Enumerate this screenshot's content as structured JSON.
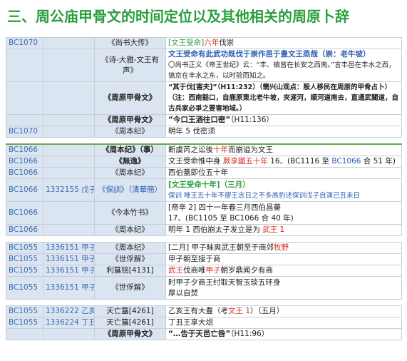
{
  "heading": "三、周公庙甲骨文的时间定位以及其他相关的周原卜辞",
  "rows": [
    {
      "c1": "BC1070",
      "c2": "",
      "c3": "《尚书大传》",
      "c4": [
        [
          "[文王受命]",
          "green"
        ],
        [
          "六年",
          "red"
        ],
        [
          "伐崇",
          ""
        ]
      ]
    },
    {
      "c1": "",
      "c2": "",
      "c3": "《诗-大雅-文王有声》",
      "c4a": "文王受命有此武功既伐于崇作邑于豊文王烝哉（崇：老牛坡）",
      "c4b": "〇尚书正义《帝王世纪》云：“丰、镐皆在长安之西南。”言丰邑在丰水之西，镐京在丰水之东，以时验而知之。"
    },
    {
      "c1": "",
      "c2": "",
      "c3": "《周原甲骨文》",
      "c4a": "“其于伐[害夫]”（H11:232）（需兴山观点：殷人移民在周原的甲骨占卜）",
      "c4b": "（注：西南豁口，自鹿原東北老牛坡，夾滻河，順河道南去，直通武關道，自古兵家必爭之要害地域。）"
    },
    {
      "c1": "",
      "c2": "",
      "c3": "《周原甲骨文》",
      "c4": [
        [
          "“今口王酒往口密”",
          "b"
        ],
        [
          "（H11:136）",
          ""
        ]
      ]
    },
    {
      "c1": "BC1070",
      "c2": "",
      "c3": "《周本纪》",
      "c4": [
        [
          "明年 5 伐密须",
          ""
        ]
      ]
    },
    {
      "c1": "BC1066",
      "c2": "",
      "c3": "《周本纪》（事）",
      "c4": [
        [
          "断虞芮之讼後",
          ""
        ],
        [
          "十年",
          "red"
        ],
        [
          "而崩谥为文王",
          ""
        ]
      ]
    },
    {
      "c1": "BC1066",
      "c2": "",
      "c3": "《無逸》",
      "c4": [
        [
          "文王受命惟中身 ",
          ""
        ],
        [
          "厥享國五十年",
          "red"
        ],
        [
          "    16、(BC1116 至 ",
          ""
        ],
        [
          "BC1066",
          "blue"
        ],
        [
          " 合 51 年)",
          ""
        ]
      ]
    },
    {
      "c1": "BC1066",
      "c2": "",
      "c3": "《周本纪》",
      "c4": [
        [
          "西伯蓋即位五十年",
          ""
        ]
      ]
    },
    {
      "c1": "BC1066",
      "c2": "1332155 戊子",
      "c3": "《保訓》（清華簡）",
      "c4a": "[文王受命十年]（三月）",
      "c4b": "保训  唯王五十年不瘳王念日之不多高豹述保训戊子自演己丑未日"
    },
    {
      "c1": "BC1066",
      "c2": "",
      "c3": "《今本竹书》",
      "c4a": "[帝辛 2] 四十一年春三月西伯昌薨",
      "c4b": "17、(BC1105 至 BC1066 合 40 年)"
    },
    {
      "c1": "BC1066",
      "c2": "",
      "c3": "《周本纪》",
      "c4": [
        [
          "明年 1  西伯崩太子发立是为 ",
          ""
        ],
        [
          "武王 1",
          "red"
        ]
      ]
    },
    {
      "c1": "BC1055",
      "c2": "1336151 甲子",
      "c3": "《周本纪》",
      "c4": [
        [
          "[二月] 甲子昧爽武王朝至于商郊",
          ""
        ],
        [
          "牧野",
          "red"
        ]
      ]
    },
    {
      "c1": "BC1055",
      "c2": "1336151 甲子",
      "c3": "《世俘解》",
      "c4": [
        [
          "甲子朝至接于商",
          ""
        ]
      ]
    },
    {
      "c1": "BC1055",
      "c2": "1336151 甲子",
      "c3": "利簋铭[4131]",
      "c4": [
        [
          "武王",
          "red"
        ],
        [
          "伐商唯",
          ""
        ],
        [
          "甲子",
          "red"
        ],
        [
          "朝岁鼎闻夕有商",
          ""
        ]
      ]
    },
    {
      "c1": "BC1055",
      "c2": "1336151 甲子",
      "c3": "《世俘解》",
      "c4a": "时甲子夕商王纣取天智玉琰五环身",
      "c4b": "厚以自焚"
    },
    {
      "c1": "BC1055",
      "c2": "1336222 乙亥",
      "c3": "天亡簋[4261]",
      "c4": [
        [
          "乙亥王有大豊（考",
          ""
        ],
        [
          "文王 1",
          "red"
        ],
        [
          "）（五月）",
          ""
        ]
      ]
    },
    {
      "c1": "BC1055",
      "c2": "1336224 丁丑",
      "c3": "天亡簋[4261]",
      "c4": [
        [
          "丁丑王享大俎",
          ""
        ]
      ]
    },
    {
      "c1": "",
      "c2": "",
      "c3": "《周原甲骨文》",
      "c4": [
        [
          "“…告于天邑亡咎”",
          "b"
        ],
        [
          "（H11:96）",
          ""
        ]
      ]
    }
  ]
}
